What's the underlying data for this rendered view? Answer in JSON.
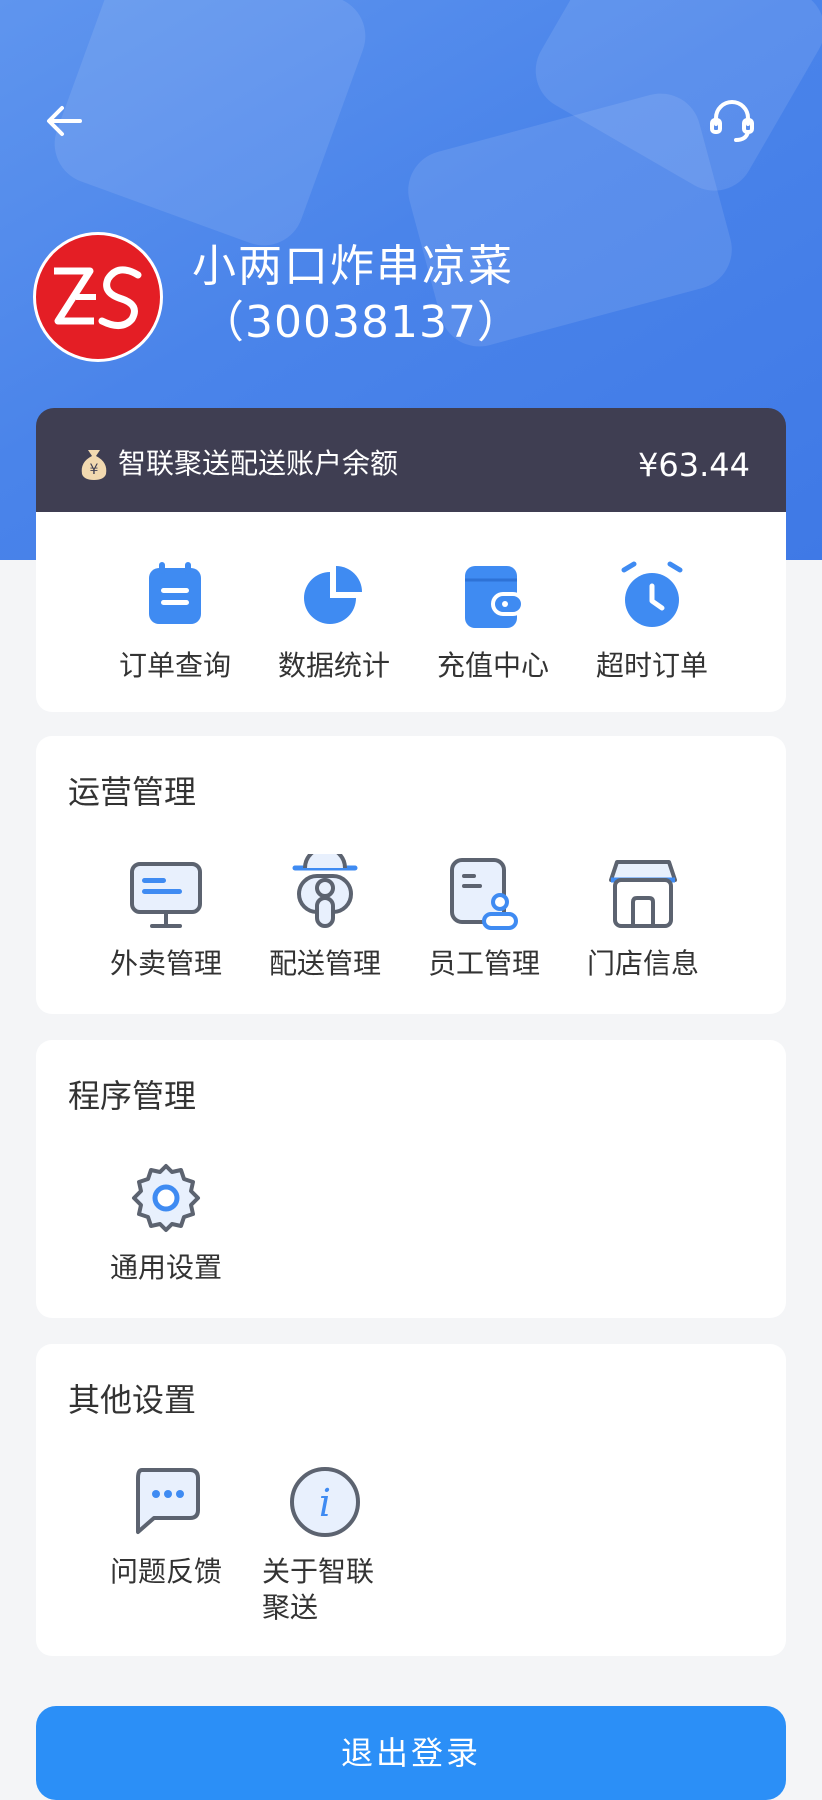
{
  "store": {
    "name": "小两口炸串凉菜",
    "id": "（30038137）"
  },
  "balance": {
    "label": "智联聚送配送账户余额",
    "amount": "¥63.44"
  },
  "quick": [
    {
      "label": "订单查询",
      "icon": "order-icon"
    },
    {
      "label": "数据统计",
      "icon": "pie-chart-icon"
    },
    {
      "label": "充值中心",
      "icon": "wallet-icon"
    },
    {
      "label": "超时订单",
      "icon": "alarm-clock-icon"
    }
  ],
  "operations": {
    "title": "运营管理",
    "items": [
      {
        "label": "外卖管理",
        "icon": "monitor-icon"
      },
      {
        "label": "配送管理",
        "icon": "rider-icon"
      },
      {
        "label": "员工管理",
        "icon": "staff-card-icon"
      },
      {
        "label": "门店信息",
        "icon": "store-icon"
      }
    ]
  },
  "program": {
    "title": "程序管理",
    "items": [
      {
        "label": "通用设置",
        "icon": "gear-icon"
      }
    ]
  },
  "other": {
    "title": "其他设置",
    "items": [
      {
        "label": "问题反馈",
        "icon": "chat-bubble-icon"
      },
      {
        "label": "关于智联聚送",
        "icon": "info-icon"
      }
    ]
  },
  "logout_label": "退出登录",
  "colors": {
    "primary": "#2b8ff7",
    "hero": "#4a84ea",
    "balance_bg": "#3f3e52",
    "logo_red": "#e41e25",
    "icon_blue": "#3f8bf2",
    "icon_gray": "#5c6370"
  }
}
